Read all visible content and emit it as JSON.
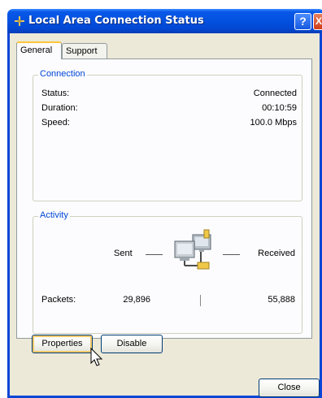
{
  "window": {
    "title": "Local Area Connection Status"
  },
  "titlebar_buttons": {
    "help": "?",
    "close": "X"
  },
  "tabs": [
    {
      "label": "General",
      "selected": true
    },
    {
      "label": "Support",
      "selected": false
    }
  ],
  "connection": {
    "title": "Connection",
    "rows": [
      {
        "label": "Status:",
        "value": "Connected"
      },
      {
        "label": "Duration:",
        "value": "00:10:59"
      },
      {
        "label": "Speed:",
        "value": "100.0 Mbps"
      }
    ]
  },
  "activity": {
    "title": "Activity",
    "sent_label": "Sent",
    "received_label": "Received",
    "packets_label": "Packets:",
    "sent_value": "29,896",
    "received_value": "55,888"
  },
  "buttons": {
    "properties": "Properties",
    "disable": "Disable",
    "close": "Close"
  },
  "icons": {
    "title": "network-connection-icon",
    "activity": "network-computers-icon"
  },
  "colors": {
    "titlebar": "#0351df",
    "group_title": "#0046d5",
    "dialog_bg": "#ece9d8"
  }
}
